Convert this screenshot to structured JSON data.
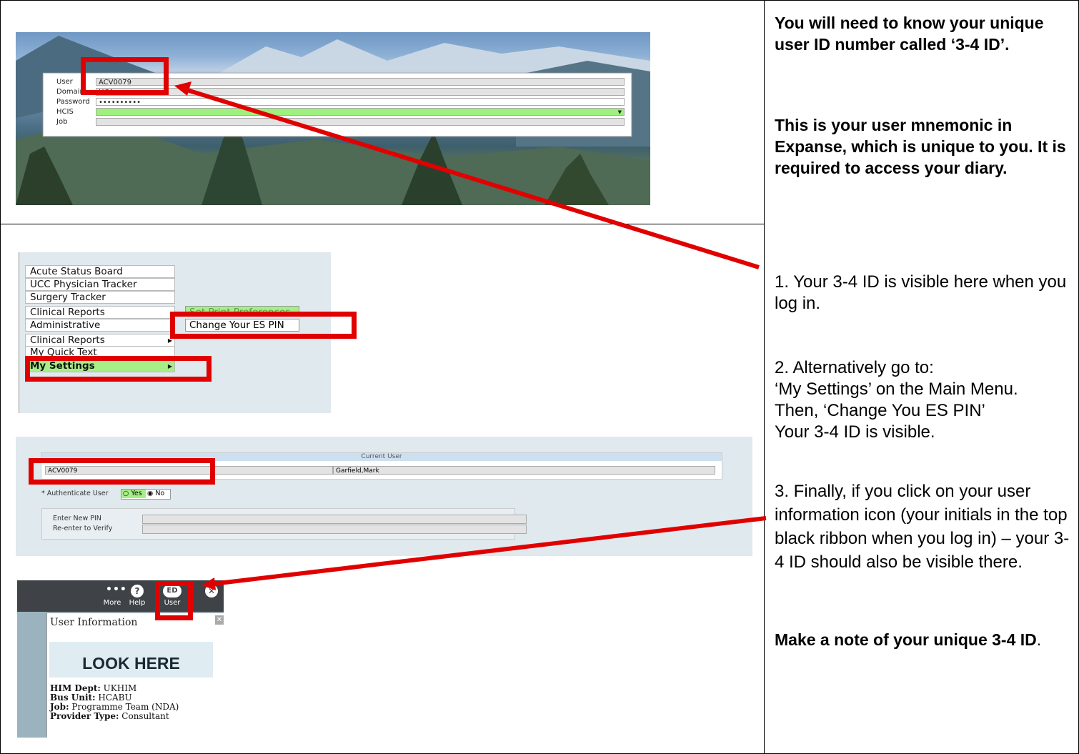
{
  "login": {
    "labels": [
      "User",
      "Domain",
      "Password",
      "HCIS",
      "Job"
    ],
    "user_value": "ACV0079",
    "domain_value": "HCA",
    "password_value": "••••••••••"
  },
  "menu": {
    "items": [
      "Acute Status Board",
      "UCC Physician Tracker",
      "Surgery Tracker",
      "Clinical Reports",
      "Administrative",
      "Clinical Reports",
      "My Quick Text",
      "My Settings"
    ],
    "submenu": [
      "Set Print Preferences",
      "Change Your ES PIN"
    ]
  },
  "current_user": {
    "header": "Current User",
    "id_value": "ACV0079",
    "name_value": "Garfield,Mark",
    "authenticate_label": "* Authenticate User",
    "yes_label": "Yes",
    "no_label": "No",
    "new_pin_label": "Enter New PIN",
    "verify_label": "Re-enter to Verify"
  },
  "ribbon": {
    "more_label": "More",
    "help_label": "Help",
    "user_initials": "ED",
    "user_label": "User",
    "popup_title": "User Information",
    "look_here": "LOOK HERE",
    "him_dept_key": "HIM Dept:",
    "him_dept_val": "UKHIM",
    "bus_unit_key": "Bus Unit:",
    "bus_unit_val": "HCABU",
    "job_key": "Job:",
    "job_val": "Programme Team (NDA)",
    "provider_key": "Provider Type:",
    "provider_val": "Consultant"
  },
  "instructions": {
    "intro_bold": "You will need to know your unique user ID number called ‘3-4 ID’.",
    "mnemonic_bold": "This is your user mnemonic in Expanse, which is unique to you. It is required to access your diary.",
    "step1": "1. Your 3-4 ID is visible here when you log in.",
    "step2_line1": "2. Alternatively go to:",
    "step2_line2": "‘My Settings’ on the Main Menu.",
    "step2_line3": "Then, ‘Change You ES PIN’",
    "step2_line4": "Your 3-4 ID is visible.",
    "step3": "3. Finally, if you click on your user information icon (your initials in the top black ribbon when you log in) – your 3-4 ID should also be visible there.",
    "note_bold": "Make a note of your unique 3-4 ID",
    "note_end": "."
  },
  "colors": {
    "highlight_red": "#e00000",
    "menu_green": "#a6ef86"
  }
}
